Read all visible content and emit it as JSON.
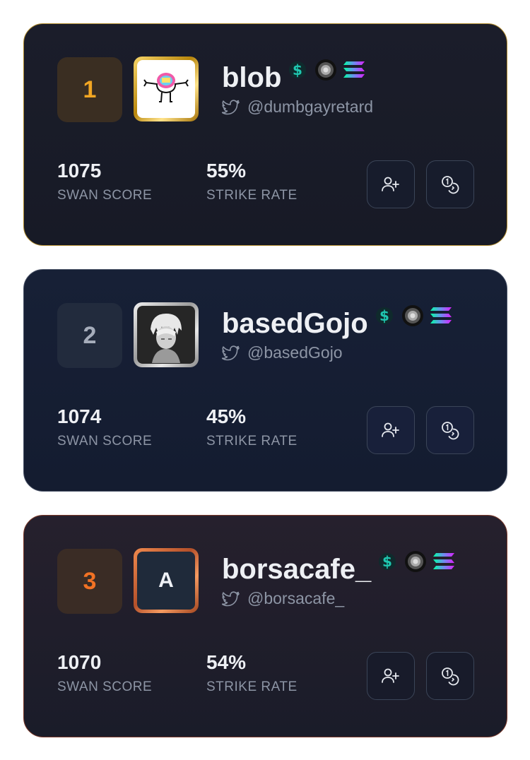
{
  "cards": [
    {
      "rank": "1",
      "name": "blob",
      "handle": "@dumbgayretard",
      "score": "1075",
      "score_label": "SWAN SCORE",
      "strike_rate": "55%",
      "strike_label": "STRIKE RATE",
      "avatar_letter": ""
    },
    {
      "rank": "2",
      "name": "basedGojo",
      "handle": "@basedGojo",
      "score": "1074",
      "score_label": "SWAN SCORE",
      "strike_rate": "45%",
      "strike_label": "STRIKE RATE",
      "avatar_letter": ""
    },
    {
      "rank": "3",
      "name": "borsacafe_",
      "handle": "@borsacafe_",
      "score": "1070",
      "score_label": "SWAN SCORE",
      "strike_rate": "54%",
      "strike_label": "STRIKE RATE",
      "avatar_letter": "A"
    }
  ],
  "icons": {
    "badges": [
      "dollar-badge-icon",
      "coin-badge-icon",
      "solana-badge-icon"
    ],
    "handle": "twitter-icon",
    "buttons": [
      "add-user-icon",
      "coins-icon"
    ]
  },
  "colors": {
    "gold_rank": "#f2a623",
    "silver_rank": "#a6adbb",
    "bronze_rank": "#f27224",
    "dollar_badge": "#1fc7b0"
  }
}
